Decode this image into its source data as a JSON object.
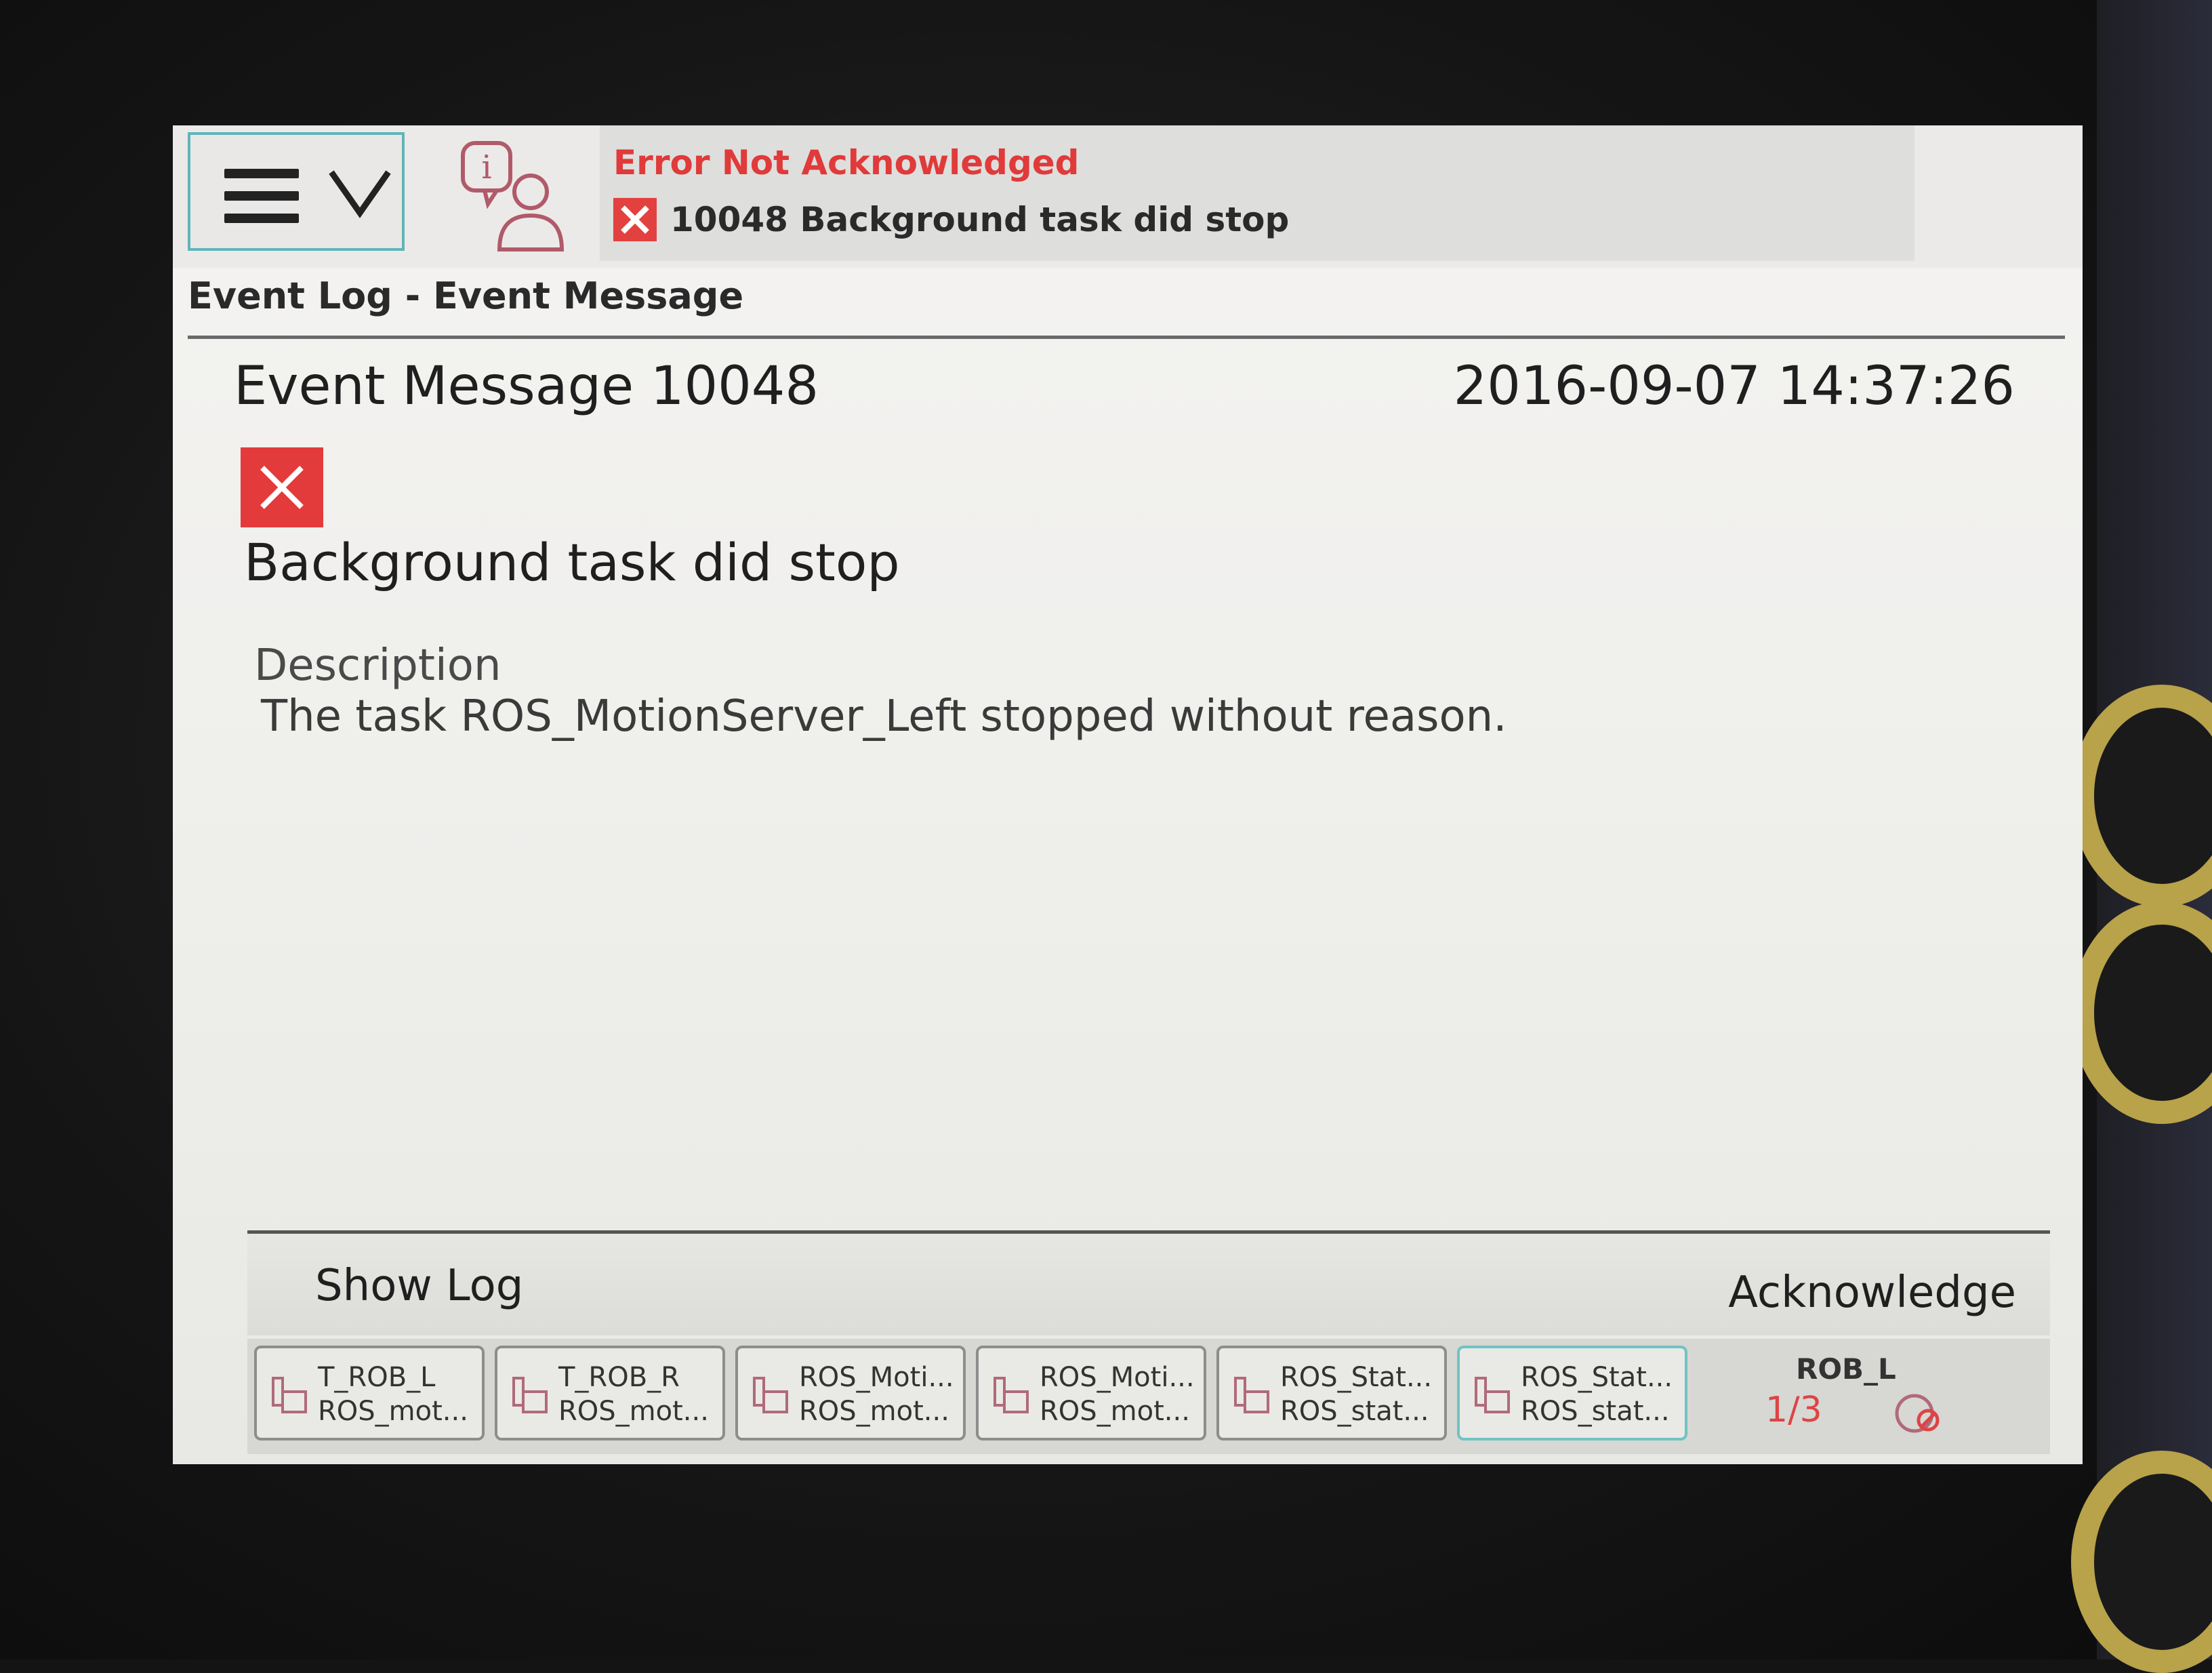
{
  "header": {
    "menu_icon": "hamburger-menu-icon",
    "info_icon": "info-user-icon",
    "alert_title": "Error Not Acknowledged",
    "alert_message": "10048 Background task did stop",
    "breadcrumb": "Event Log - Event Message"
  },
  "message": {
    "title": "Event Message 10048",
    "timestamp": "2016-09-07 14:37:26",
    "severity_icon": "error-x-icon",
    "headline": "Background task did stop",
    "description_label": "Description",
    "description_text": "The task ROS_MotionServer_Left stopped without reason."
  },
  "footer": {
    "show_log_label": "Show Log",
    "acknowledge_label": "Acknowledge"
  },
  "tasks": [
    {
      "line1": "T_ROB_L",
      "line2": "ROS_mot..."
    },
    {
      "line1": "T_ROB_R",
      "line2": "ROS_mot..."
    },
    {
      "line1": "ROS_Moti...",
      "line2": "ROS_mot..."
    },
    {
      "line1": "ROS_Moti...",
      "line2": "ROS_mot..."
    },
    {
      "line1": "ROS_Stat...",
      "line2": "ROS_stat..."
    },
    {
      "line1": "ROS_Stat...",
      "line2": "ROS_stat..."
    }
  ],
  "robot": {
    "label": "ROB_L",
    "fraction": "1/3"
  },
  "colors": {
    "error_red": "#e33b3b",
    "accent_teal": "#5fb5b8"
  }
}
